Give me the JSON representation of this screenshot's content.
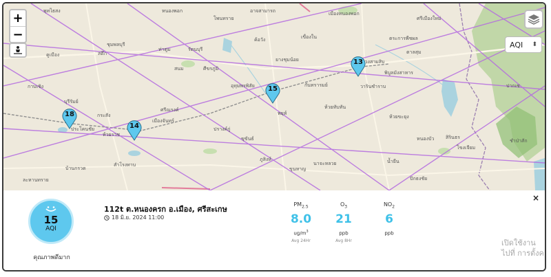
{
  "map": {
    "zoom_in": "+",
    "zoom_out": "−",
    "layer_select": {
      "value": "AQI",
      "arrow": "⬍"
    },
    "labels": [
      "พุทไธสง",
      "หนองพอก",
      "โพนทราย",
      "อาจสามารถ",
      "เมืองหนองพอก",
      "ศรีเมืองใหม่",
      "ชุมพลบุรี",
      "ท่าตูม",
      "รัตนบุรี",
      "ค้อวัง",
      "เขื่องใน",
      "ตระการพืชผล",
      "สตึก",
      "สนม",
      "ศีขรภูมิ",
      "ยางชุมน้อย",
      "ม่วงสามสิบ",
      "ตาลสุม",
      "คูเมือง",
      "กาบเชิง",
      "อุทุมพรพิสัย",
      "กันทรารมย์",
      "วารินชำราบ",
      "พิบูลมังสาหาร",
      "บุรีรัมย์",
      "ประโคนชัย",
      "ศรีณรงค์",
      "เมืองจันทร์",
      "ห้วยทับทัน",
      "พยุห์",
      "ขุขันธ์",
      "ปรางค์กู่",
      "ห้วยราช",
      "กระสัง",
      "สำโรงทาบ",
      "ขุนหาญ",
      "บ้านกรวด",
      "ละหานทราย",
      "ปักธงชัย",
      "นาจะหลวย",
      "น้ำยืน",
      "สิรินธร",
      "ปากเซ",
      "โขงเจียม",
      "ชำป่าสัก",
      "หนองบัว",
      "ห้วยขะยุง",
      "ภูสิงห์"
    ],
    "markers": [
      {
        "name": "marker-18",
        "value": "18"
      },
      {
        "name": "marker-14",
        "value": "14"
      },
      {
        "name": "marker-15",
        "value": "15"
      },
      {
        "name": "marker-13",
        "value": "13"
      }
    ],
    "colors": {
      "marker": "#5ec8ee",
      "land": "#eee9dc",
      "forest": "#b5d29b",
      "water": "#aad3df",
      "boundary": "#b46be0"
    }
  },
  "panel": {
    "close": "×",
    "aqi": {
      "value": "15",
      "unit": "AQI",
      "quality": "คุณภาพดีมาก",
      "color": "#5ec8ee"
    },
    "station": "112t ต.หนองครก อ.เมือง, ศรีสะเกษ",
    "datetime": "18 มิ.ย. 2024 11:00",
    "pollutants": [
      {
        "name": "PM",
        "sub": "2.5",
        "value": "8.0",
        "unit": "ug/m",
        "unit_sup": "3",
        "avg": "Avg 24Hr"
      },
      {
        "name": "O",
        "sub": "3",
        "value": "21",
        "unit": "ppb",
        "unit_sup": "",
        "avg": "Avg 8Hr"
      },
      {
        "name": "NO",
        "sub": "2",
        "value": "6",
        "unit": "ppb",
        "unit_sup": "",
        "avg": ""
      }
    ]
  },
  "watermark": {
    "line1": "เปิดใช้งาน",
    "line2": "ไปที่ การตั้งค"
  }
}
